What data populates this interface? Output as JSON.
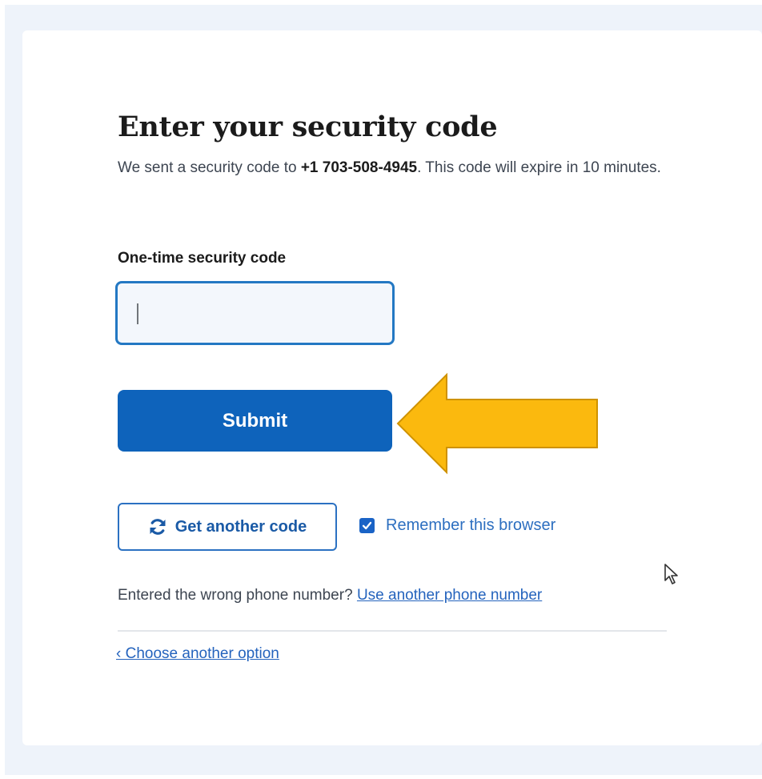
{
  "page": {
    "title": "Enter your security code",
    "intro_prefix": "We sent a security code to ",
    "phone_number": "+1 703-508-4945",
    "intro_suffix": ". This code will expire in 10 minutes."
  },
  "form": {
    "code_label": "One-time security code",
    "code_value": "",
    "submit_label": "Submit"
  },
  "actions": {
    "resend_label": "Get another code",
    "resend_icon": "refresh-icon",
    "remember_label": "Remember this browser",
    "remember_checked": true
  },
  "footer": {
    "wrong_number_text": "Entered the wrong phone number?",
    "use_another_link": "Use another phone number",
    "choose_option_link": "‹ Choose another option"
  },
  "annotation": {
    "arrow_icon": "left-arrow-icon",
    "arrow_color": "#fbb90e"
  },
  "colors": {
    "primary": "#0e63bb",
    "link": "#2463bd",
    "background": "#eef3fa"
  }
}
